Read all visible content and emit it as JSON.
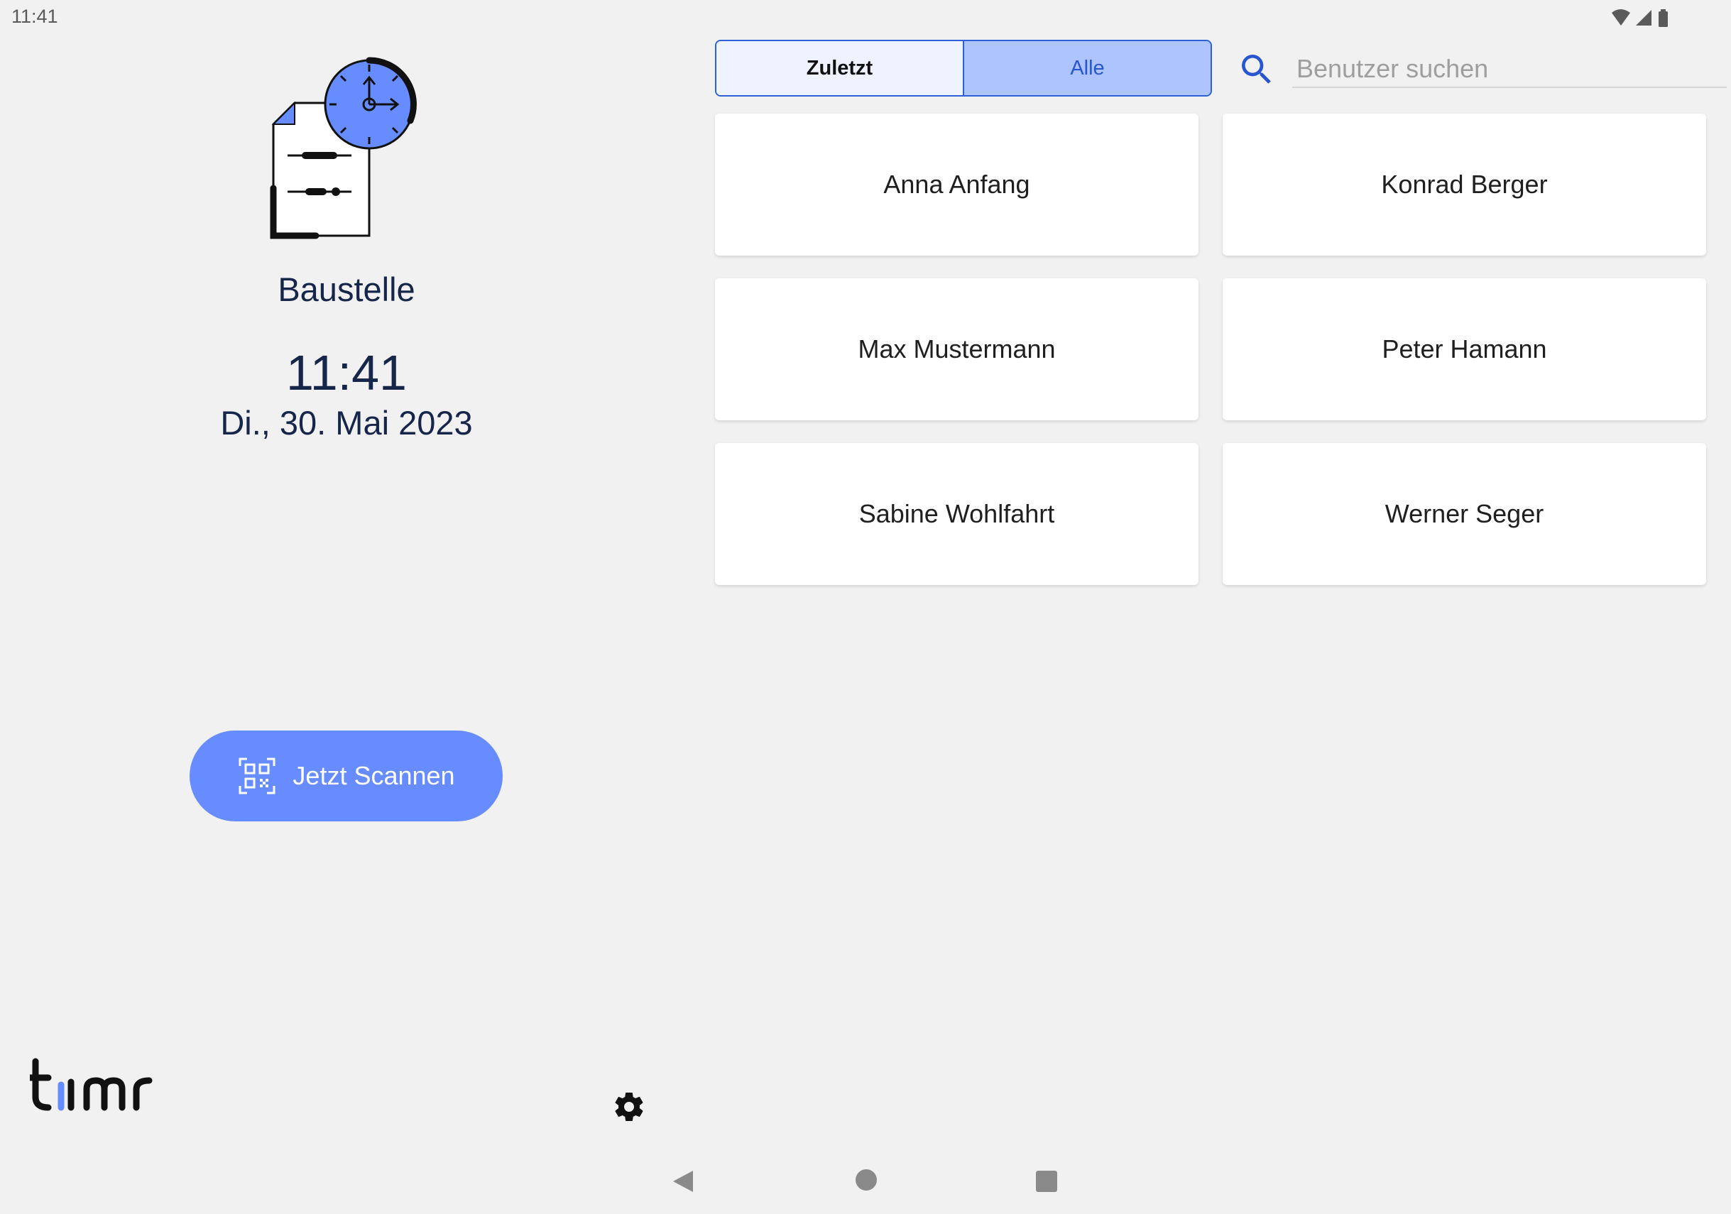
{
  "status_bar": {
    "time": "11:41",
    "icons": [
      "wifi-icon",
      "signal-icon",
      "battery-icon"
    ]
  },
  "left_panel": {
    "location": "Baustelle",
    "time": "11:41",
    "date": "Di., 30. Mai 2023",
    "scan_button_label": "Jetzt Scannen",
    "logo_text": "timr"
  },
  "tabs": [
    {
      "label": "Zuletzt",
      "selected": false
    },
    {
      "label": "Alle",
      "selected": true
    }
  ],
  "search": {
    "placeholder": "Benutzer suchen",
    "value": ""
  },
  "users": [
    "Anna Anfang",
    "Konrad Berger",
    "Max Mustermann",
    "Peter Hamann",
    "Sabine Wohlfahrt",
    "Werner Seger"
  ],
  "colors": {
    "accent": "#668cff",
    "tab_border": "#2f5fd9",
    "tab_selected_bg": "#aec4ff",
    "tab_unselected_bg": "#eef3ff",
    "text_dark_blue": "#16254a",
    "background": "#f1f1f1"
  }
}
